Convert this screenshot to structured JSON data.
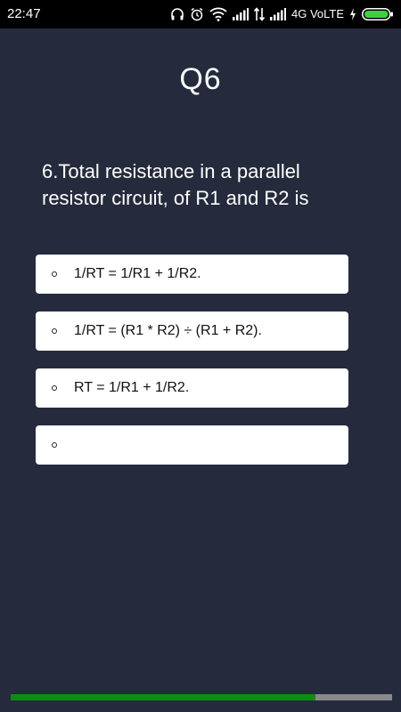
{
  "status_bar": {
    "time": "22:47",
    "network_label": "4G VoLTE",
    "icons": [
      "headphones-icon",
      "alarm-icon",
      "wifi-icon",
      "signal-icon",
      "data-arrows-icon",
      "signal-icon",
      "charging-icon",
      "battery-icon"
    ],
    "battery_color": "#3cd23c"
  },
  "quiz": {
    "title": "Q6",
    "question": "6.Total resistance in a parallel resistor circuit, of R1 and R2 is",
    "options": [
      {
        "label": "1/RT = 1/R1 + 1/R2."
      },
      {
        "label": "1/RT = (R1 * R2) ÷ (R1 + R2)."
      },
      {
        "label": "RT = 1/R1 + 1/R2."
      },
      {
        "label": ""
      }
    ]
  },
  "progress": {
    "value": 0.8,
    "fill_color": "#0f8b16",
    "track_color": "#8a8a8a"
  },
  "theme": {
    "background": "#252a3c",
    "option_background": "#ffffff"
  }
}
